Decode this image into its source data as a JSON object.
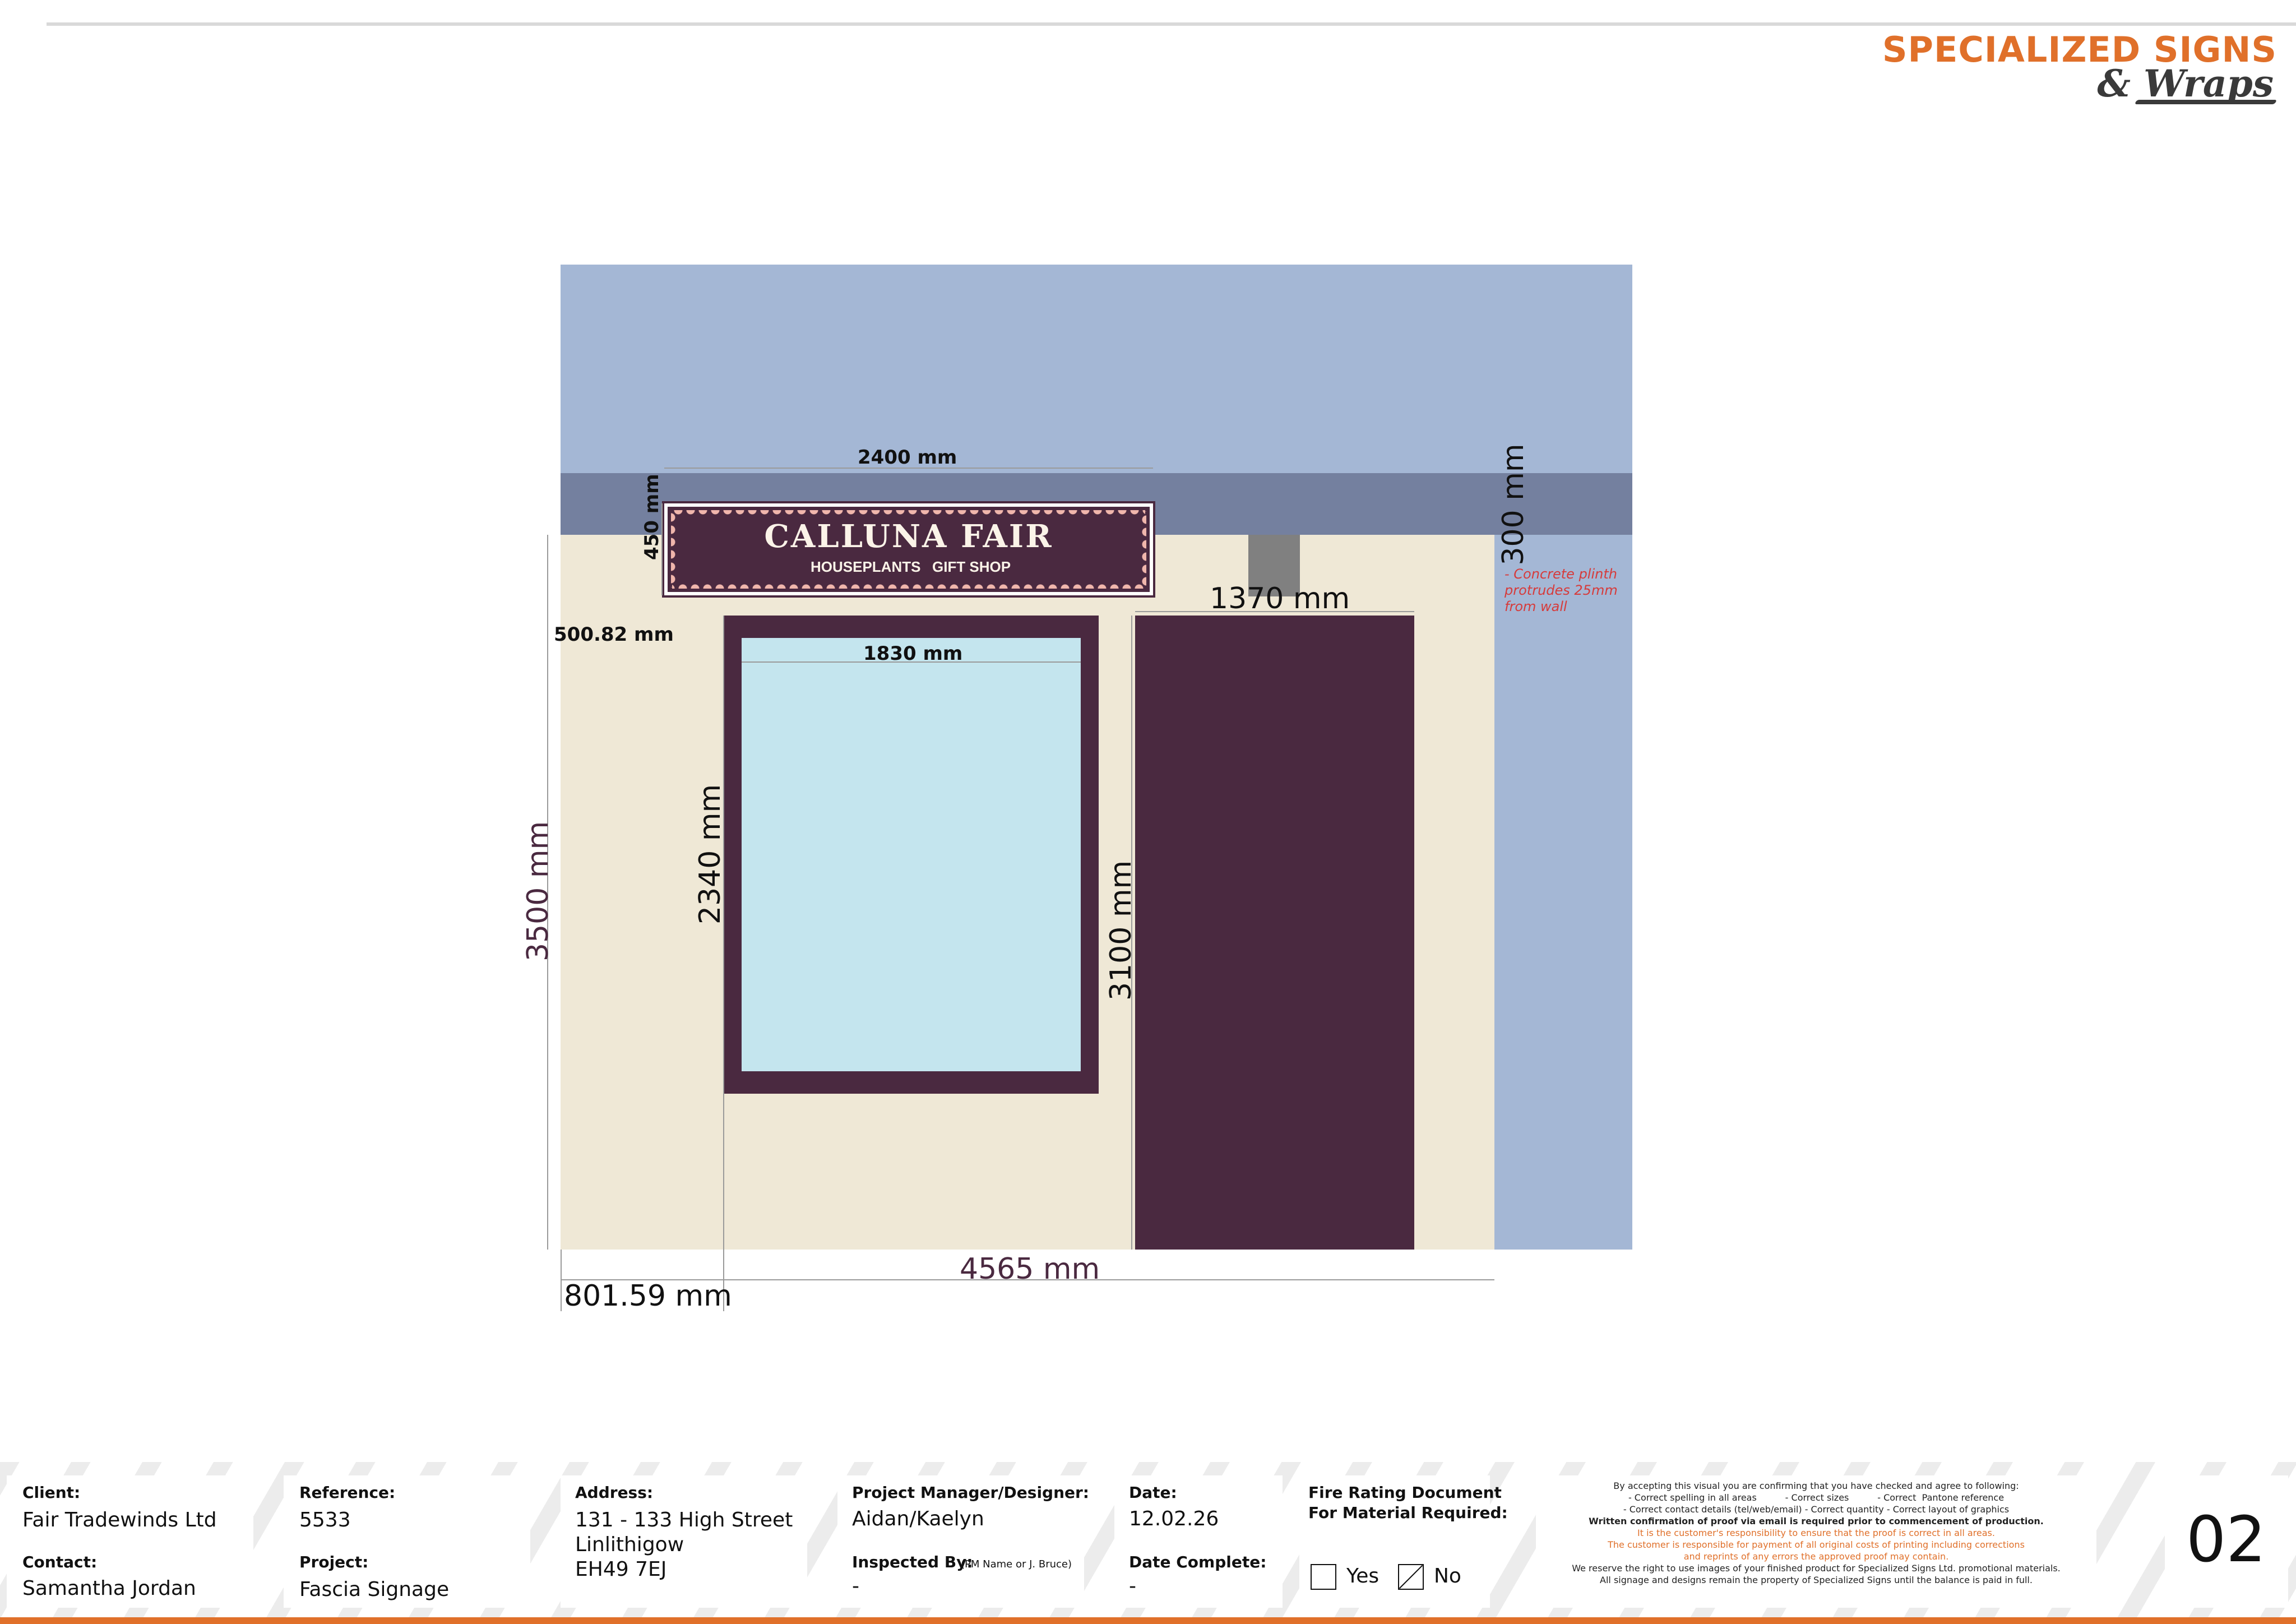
{
  "logo": {
    "line1": "SPECIALIZED SIGNS",
    "line2": "& Wraps"
  },
  "sign": {
    "title": "CALLUNA FAIR",
    "subtitle_left": "HOUSEPLANTS",
    "subtitle_right": "GIFT SHOP",
    "colors": {
      "panel": "#4a2940",
      "scallop": "#f0b6ac"
    }
  },
  "dimensions": {
    "sign_width": "2400 mm",
    "sign_height": "450 mm",
    "window_width": "1830 mm",
    "window_height": "2340 mm",
    "door_width": "1370 mm",
    "door_height": "3100 mm",
    "total_height": "3500 mm",
    "total_width": "4565 mm",
    "left_offset": "801.59 mm",
    "top_offset": "500.82 mm",
    "right_band": "300 mm"
  },
  "note": "- Concrete plinth protrudes 25mm from wall",
  "footer": {
    "client_label": "Client:",
    "client": "Fair Tradewinds Ltd",
    "contact_label": "Contact:",
    "contact": "Samantha Jordan",
    "reference_label": "Reference:",
    "reference": "5533",
    "project_label": "Project:",
    "project": "Fascia Signage",
    "address_label": "Address:",
    "address_line1": "131 - 133 High Street",
    "address_line2": "Linlithigow",
    "address_line3": "EH49 7EJ",
    "pm_label": "Project Manager/Designer:",
    "pm": "Aidan/Kaelyn",
    "inspected_label": "Inspected By:",
    "inspected_hint": "(PM Name or J. Bruce)",
    "inspected": "-",
    "date_label": "Date:",
    "date": "12.02.26",
    "date_complete_label": "Date Complete:",
    "date_complete": "-",
    "fire_label_1": "Fire Rating Document",
    "fire_label_2": "For Material Required:",
    "yes_label": "Yes",
    "no_label": "No",
    "fire_rating_required": false,
    "legal_1": "By accepting this visual you are confirming that you have checked and agree to following:",
    "legal_2": "- Correct spelling in all areas          - Correct sizes          - Correct  Pantone reference",
    "legal_3": "- Correct contact details (tel/web/email)  - Correct quantity  - Correct layout of graphics",
    "legal_4": "Written confirmation of proof via email is required prior to commencement of production.",
    "legal_5": "It is the customer's responsibility to ensure that the proof is correct in all areas.",
    "legal_6": "The customer is responsible for payment of all original costs of printing including corrections",
    "legal_7": "and reprints of any errors the approved proof may contain.",
    "legal_8": "We reserve the right to use images of your finished product for Specialized Signs Ltd. promotional materials.",
    "legal_9": "All signage and designs remain the property of Specialized Signs until the balance is paid in full.",
    "page_number": "02"
  }
}
